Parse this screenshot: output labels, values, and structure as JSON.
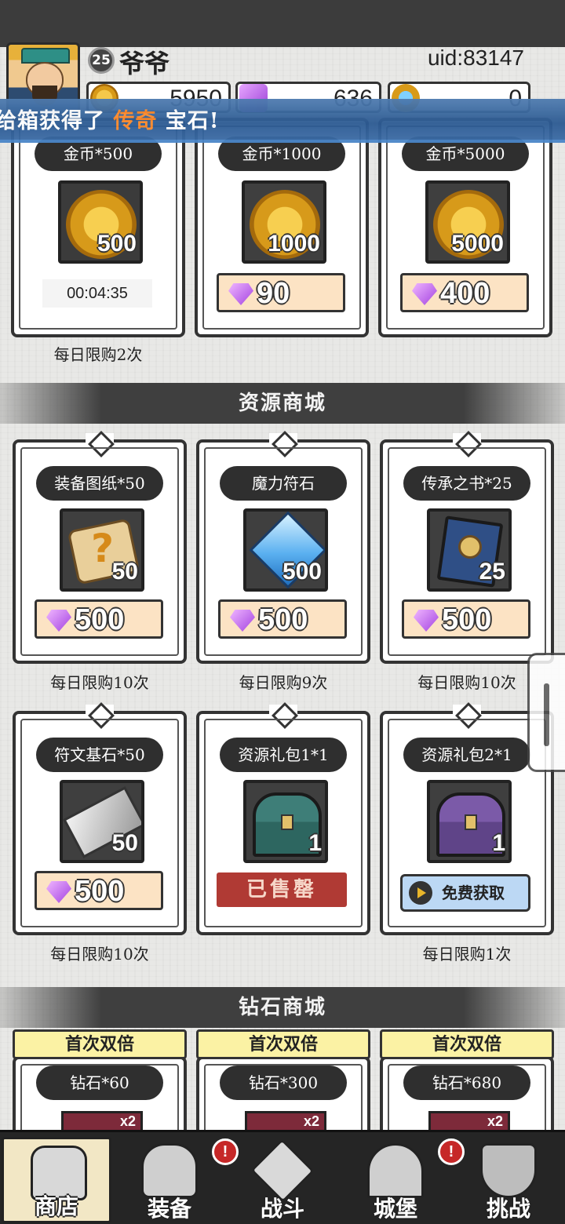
{
  "header": {
    "level": "25",
    "player_name": "爷爷",
    "uid": "uid:83147",
    "resources": [
      {
        "icon": "gold-coin-icon",
        "value": "5950"
      },
      {
        "icon": "diamond-icon",
        "value": "636"
      },
      {
        "icon": "crystal-icon",
        "value": "0"
      }
    ]
  },
  "banner": {
    "prefix": "给箱获得了 ",
    "highlight": "传奇",
    "suffix": " 宝石!"
  },
  "gold_cards": [
    {
      "title": "金币*500",
      "qty": "500",
      "timer": "00:04:35"
    },
    {
      "title": "金币*1000",
      "qty": "1000",
      "price": "90"
    },
    {
      "title": "金币*5000",
      "qty": "5000",
      "price": "400"
    }
  ],
  "gold_limit": "每日限购2次",
  "resource_section": {
    "title": "资源商城"
  },
  "resource_cards": [
    {
      "title": "装备图纸*50",
      "icon": "scroll-icon",
      "qty": "50",
      "price": "500",
      "limit": "每日限购10次"
    },
    {
      "title": "魔力符石",
      "icon": "magic-stone-icon",
      "qty": "500",
      "price": "500",
      "limit": "每日限购9次"
    },
    {
      "title": "传承之书*25",
      "icon": "book-icon",
      "qty": "25",
      "price": "500",
      "limit": "每日限购10次"
    },
    {
      "title": "符文基石*50",
      "icon": "rune-stone-icon",
      "qty": "50",
      "price": "500",
      "limit": "每日限购10次"
    },
    {
      "title": "资源礼包1*1",
      "icon": "chest-green-icon",
      "qty": "1",
      "status": "已售罄"
    },
    {
      "title": "资源礼包2*1",
      "icon": "chest-purple-icon",
      "qty": "1",
      "action": "免费获取",
      "limit": "每日限购1次"
    }
  ],
  "diamond_section": {
    "title": "钻石商城"
  },
  "diamond_cards": [
    {
      "ribbon": "首次双倍",
      "title": "钻石*60",
      "bonus": "x2"
    },
    {
      "ribbon": "首次双倍",
      "title": "钻石*300",
      "bonus": "x2"
    },
    {
      "ribbon": "首次双倍",
      "title": "钻石*680",
      "bonus": "x2"
    }
  ],
  "nav": [
    {
      "label": "商店",
      "icon": "shop-icon",
      "active": true
    },
    {
      "label": "装备",
      "icon": "bag-icon",
      "badge": "!"
    },
    {
      "label": "战斗",
      "icon": "swords-icon"
    },
    {
      "label": "城堡",
      "icon": "castle-icon",
      "badge": "!"
    },
    {
      "label": "挑战",
      "icon": "shield-icon"
    }
  ],
  "colors": {
    "banner": "#2c5a92",
    "highlight": "#ff8a2a",
    "price_bg": "#fce3c4",
    "sold_bg": "#b03a34"
  }
}
